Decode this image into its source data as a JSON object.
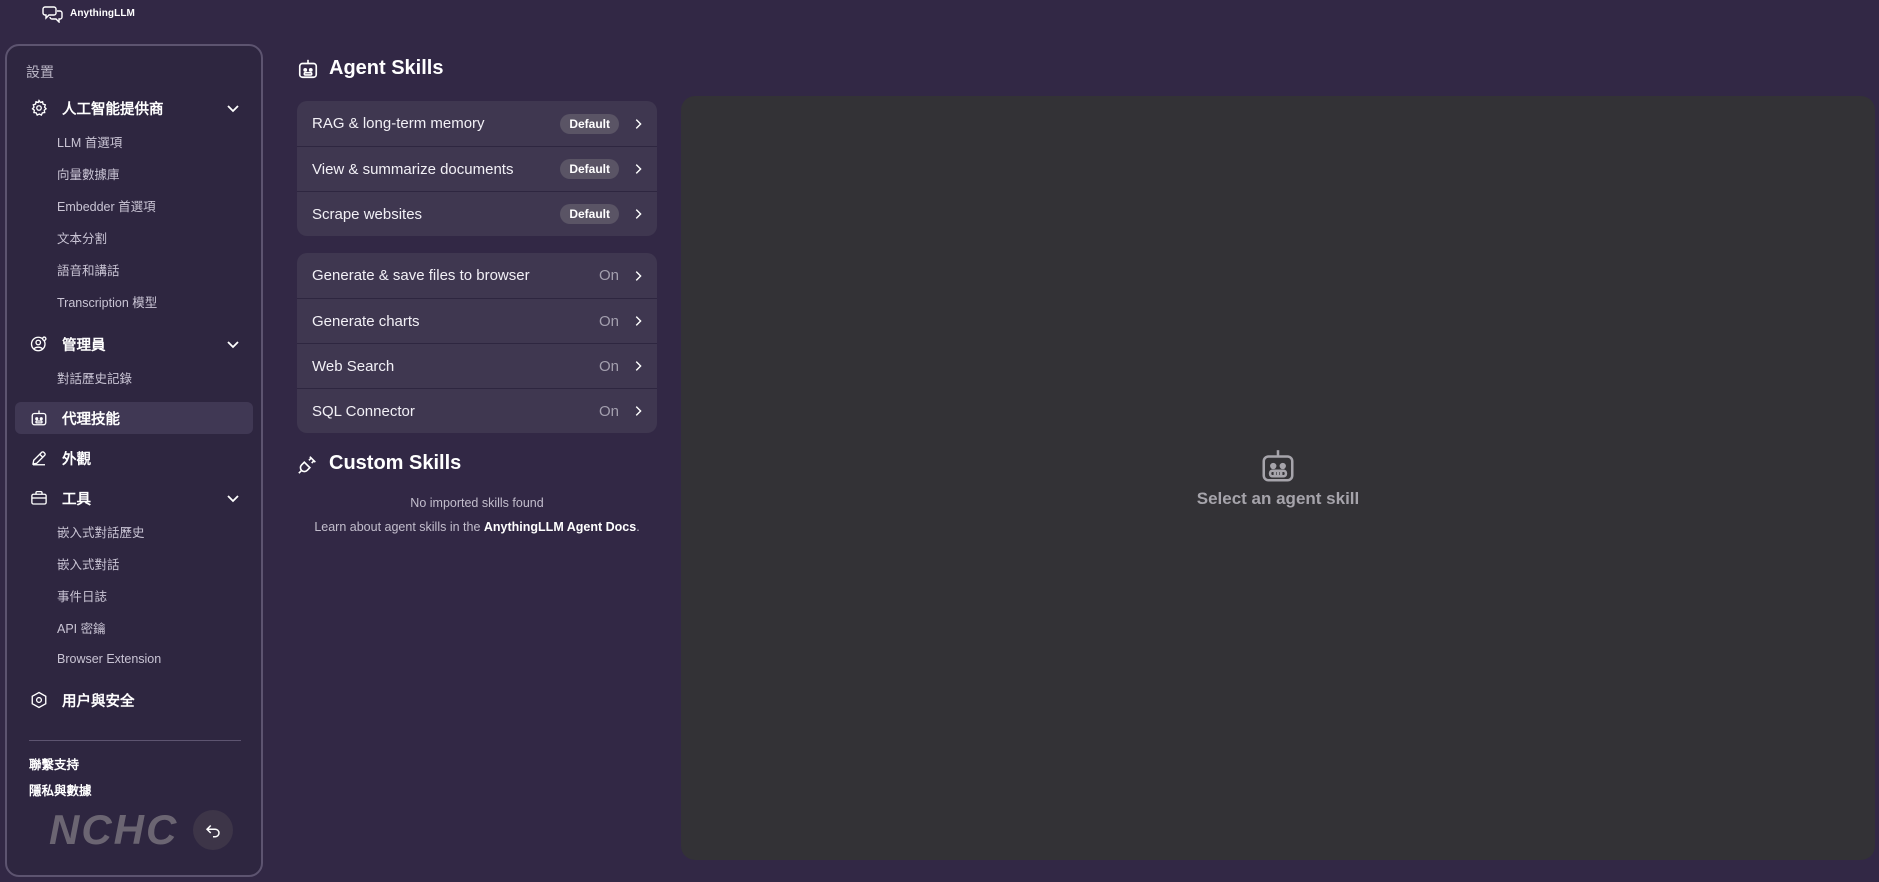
{
  "app": {
    "name": "AnythingLLM"
  },
  "sidebar": {
    "heading": "設置",
    "groups": {
      "ai_providers": {
        "label": "人工智能提供商",
        "items": [
          "LLM 首選項",
          "向量數據庫",
          "Embedder 首選項",
          "文本分割",
          "語音和講話",
          "Transcription 模型"
        ]
      },
      "admin": {
        "label": "管理員",
        "items": [
          "對話歷史記錄"
        ]
      },
      "agent_skills": {
        "label": "代理技能"
      },
      "appearance": {
        "label": "外觀"
      },
      "tools": {
        "label": "工具",
        "items": [
          "嵌入式對話歷史",
          "嵌入式對話",
          "事件日誌",
          "API 密鑰",
          "Browser Extension"
        ]
      },
      "security": {
        "label": "用户與安全"
      }
    },
    "footer": {
      "support": "聯繫支持",
      "privacy": "隱私與數據",
      "logo_text": "NCHC"
    }
  },
  "main": {
    "title": "Agent Skills",
    "default_skills": [
      {
        "name": "RAG & long-term memory",
        "badge": "Default"
      },
      {
        "name": "View & summarize documents",
        "badge": "Default"
      },
      {
        "name": "Scrape websites",
        "badge": "Default"
      }
    ],
    "configurable_skills": [
      {
        "name": "Generate & save files to browser",
        "status": "On"
      },
      {
        "name": "Generate charts",
        "status": "On"
      },
      {
        "name": "Web Search",
        "status": "On"
      },
      {
        "name": "SQL Connector",
        "status": "On"
      }
    ],
    "custom_title": "Custom Skills",
    "custom_empty": "No imported skills found",
    "custom_learn_prefix": "Learn about agent skills in the",
    "custom_learn_link": "AnythingLLM Agent Docs",
    "custom_learn_suffix": "."
  },
  "detail": {
    "empty_text": "Select an agent skill"
  },
  "colors": {
    "background": "#322845",
    "sidebar_border": "#5d5470",
    "card": "#3f3750",
    "panel": "#333236",
    "active_item": "#403854"
  }
}
